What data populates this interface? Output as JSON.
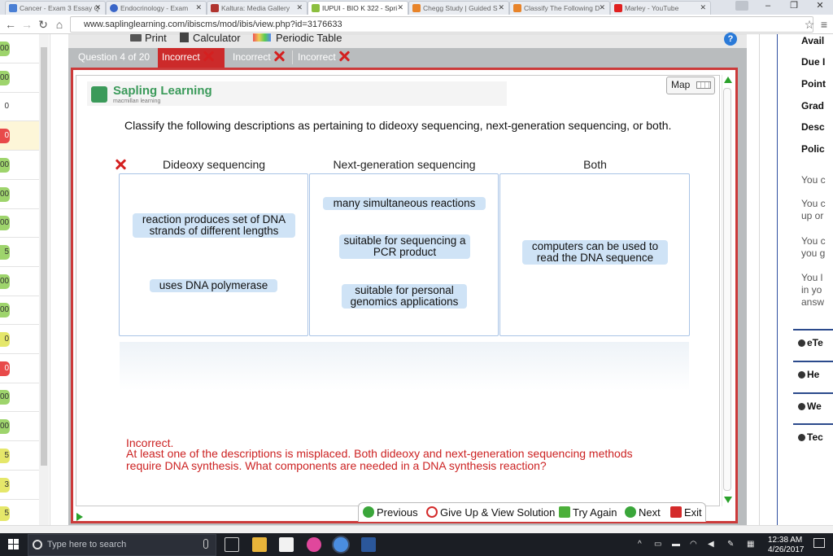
{
  "browser": {
    "tabs": [
      {
        "title": "Cancer - Exam 3 Essay Q",
        "color": "#4a7fd4"
      },
      {
        "title": "Endocrinology - Exam",
        "color": "#3a66c8"
      },
      {
        "title": "Kaltura: Media Gallery",
        "color": "#b0342f"
      },
      {
        "title": "IUPUI - BIO K 322 - Spri",
        "color": "#8cbf3f"
      },
      {
        "title": "Chegg Study | Guided S",
        "color": "#e8842a"
      },
      {
        "title": "Classify The Following D",
        "color": "#e8842a"
      },
      {
        "title": "Marley - YouTube",
        "color": "#e02020"
      }
    ],
    "url": "www.saplinglearning.com/ibiscms/mod/ibis/view.php?id=3176633"
  },
  "left_strip": {
    "rows": [
      {
        "text": "00",
        "status": "g"
      },
      {
        "text": "00",
        "status": "g"
      },
      {
        "text": "0",
        "status": "n"
      },
      {
        "text": "0",
        "status": "r",
        "highlight": true
      },
      {
        "text": "00",
        "status": "g"
      },
      {
        "text": "00",
        "status": "g"
      },
      {
        "text": "00",
        "status": "g"
      },
      {
        "text": "5",
        "status": "g"
      },
      {
        "text": "00",
        "status": "g"
      },
      {
        "text": "00",
        "status": "g"
      },
      {
        "text": "0",
        "status": "y"
      },
      {
        "text": "0",
        "status": "r"
      },
      {
        "text": "00",
        "status": "g"
      },
      {
        "text": "00",
        "status": "g"
      },
      {
        "text": "5",
        "status": "y"
      },
      {
        "text": "3",
        "status": "y"
      },
      {
        "text": "5",
        "status": "y"
      }
    ]
  },
  "toolrow": {
    "print": "Print",
    "calculator": "Calculator",
    "periodic": "Periodic Table",
    "help": "?"
  },
  "question_bar": {
    "question_label": "Question 4 of 20",
    "attempts": [
      "Incorrect",
      "Incorrect",
      "Incorrect"
    ]
  },
  "logo": {
    "name": "Sapling Learning",
    "sub": "macmillan learning"
  },
  "map_button": "Map",
  "prompt": "Classify the following descriptions as pertaining to dideoxy sequencing, next-generation sequencing, or both.",
  "columns": [
    {
      "title": "Dideoxy sequencing",
      "cards": [
        "reaction produces set of DNA strands of different lengths",
        "uses DNA polymerase"
      ]
    },
    {
      "title": "Next-generation sequencing",
      "cards": [
        "many simultaneous reactions",
        "suitable for sequencing a PCR product",
        "suitable for personal genomics applications"
      ]
    },
    {
      "title": "Both",
      "cards": [
        "computers can be used to read the DNA sequence"
      ]
    }
  ],
  "feedback": {
    "title": "Incorrect.",
    "line1": "At least one of the descriptions is misplaced. Both dideoxy and next-generation sequencing methods",
    "line2": "require DNA synthesis. What components are needed in a DNA synthesis reaction?"
  },
  "bottom_buttons": {
    "previous": "Previous",
    "giveup": "Give Up & View Solution",
    "tryagain": "Try Again",
    "next": "Next",
    "exit": "Exit"
  },
  "right_panel": {
    "labels": [
      "Avail",
      "Due I",
      "Point",
      "Grad",
      "Desc",
      "Polic"
    ],
    "texts": [
      {
        "line1": "You c",
        "line2": ""
      },
      {
        "line1": "You c",
        "line2": "up or"
      },
      {
        "line1": "You c",
        "line2": "you g"
      },
      {
        "line1": "You l",
        "line2": "in yo",
        "line3": "answ"
      }
    ],
    "buttons": [
      "eTe",
      "He",
      "We",
      "Tec"
    ]
  },
  "taskbar": {
    "search_placeholder": "Type here to search",
    "time": "12:38 AM",
    "date": "4/26/2017"
  }
}
